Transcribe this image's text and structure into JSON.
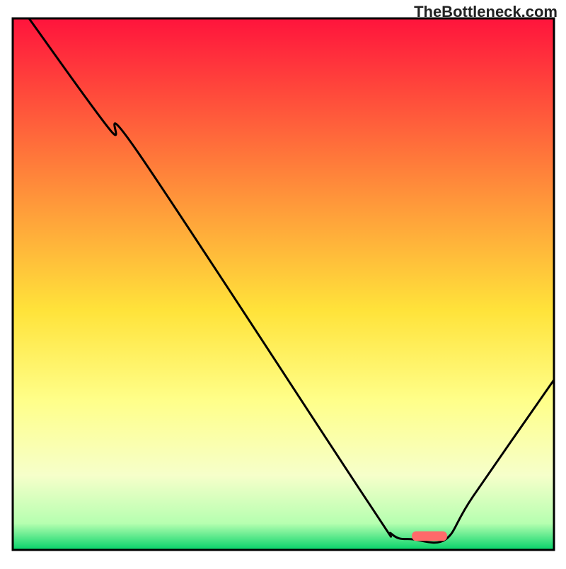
{
  "attribution": "TheBottleneck.com",
  "chart_data": {
    "type": "line",
    "title": "",
    "xlabel": "",
    "ylabel": "",
    "xlim": [
      0,
      100
    ],
    "ylim": [
      0,
      100
    ],
    "gradient_stops": [
      {
        "offset": 0,
        "color": "#ff143c"
      },
      {
        "offset": 35,
        "color": "#ff993a"
      },
      {
        "offset": 55,
        "color": "#ffe33a"
      },
      {
        "offset": 72,
        "color": "#ffff8a"
      },
      {
        "offset": 86,
        "color": "#f6ffca"
      },
      {
        "offset": 95,
        "color": "#b6ffb0"
      },
      {
        "offset": 100,
        "color": "#05d36a"
      }
    ],
    "curve": [
      {
        "x": 3,
        "y": 100
      },
      {
        "x": 18,
        "y": 79
      },
      {
        "x": 23,
        "y": 75
      },
      {
        "x": 65,
        "y": 10
      },
      {
        "x": 70,
        "y": 3
      },
      {
        "x": 74,
        "y": 2
      },
      {
        "x": 80,
        "y": 2
      },
      {
        "x": 85,
        "y": 10
      },
      {
        "x": 100,
        "y": 32
      }
    ],
    "marker": {
      "x": 77,
      "y": 2.6,
      "w": 6.5,
      "h": 1.8,
      "color": "#ff6a6a"
    }
  }
}
